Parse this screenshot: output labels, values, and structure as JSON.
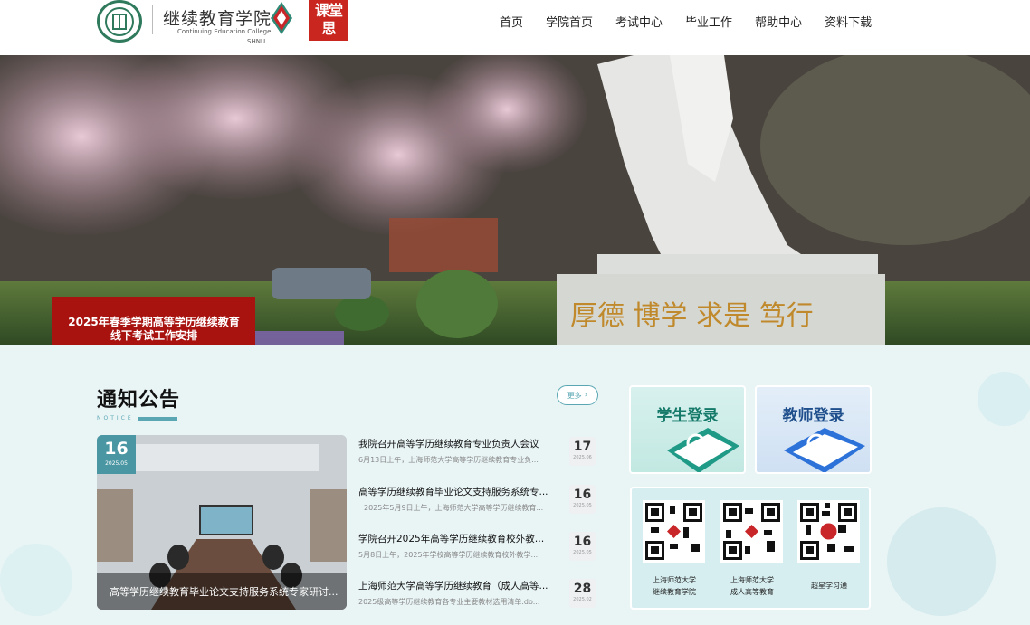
{
  "header": {
    "college_name": "继续教育学院",
    "college_en": "Continuing Education College",
    "college_abbr": "SHNU",
    "ketang_logo": "课堂思",
    "seal_text": "上海师范大学"
  },
  "nav": [
    "首页",
    "学院首页",
    "考试中心",
    "毕业工作",
    "帮助中心",
    "资料下载"
  ],
  "banner": {
    "caption": "2025年春季学期高等学历继续教育线下考试工作安排",
    "monument_text": "厚德 博学 求是 笃行"
  },
  "notices": {
    "title": "通知公告",
    "subtitle": "NOTICE",
    "more_label": "更多",
    "featured": {
      "day": "16",
      "year_month": "2025.05",
      "caption": "高等学历继续教育毕业论文支持服务系统专家研讨..."
    },
    "items": [
      {
        "title": "我院召开高等学历继续教育专业负责人会议",
        "summary": "6月13日上午，上海师范大学高等学历继续教育专业负...",
        "day": "17",
        "year_month": "2025.06"
      },
      {
        "title": "高等学历继续教育毕业论文支持服务系统专...",
        "summary": "2025年5月9日上午，上海师范大学高等学历继续教育...",
        "day": "16",
        "year_month": "2025.05"
      },
      {
        "title": "学院召开2025年高等学历继续教育校外教学...",
        "summary": "5月8日上午，2025年学校高等学历继续教育校外教学...",
        "day": "16",
        "year_month": "2025.05"
      },
      {
        "title": "上海师范大学高等学历继续教育（成人高等...",
        "summary": "2025级高等学历继续教育各专业主要教材选用清单.do...",
        "day": "28",
        "year_month": "2025.02"
      }
    ]
  },
  "login": {
    "student": "学生登录",
    "teacher": "教师登录"
  },
  "qr_codes": [
    {
      "line1": "上海师范大学",
      "line2": "继续教育学院"
    },
    {
      "line1": "上海师范大学",
      "line2": "成人高等教育"
    },
    {
      "line1": "超星学习通",
      "line2": ""
    }
  ],
  "colors": {
    "accent": "#5aa7b3",
    "banner_red": "#a8120f",
    "logo_green": "#2f7a5d",
    "ketang_red": "#c8261e"
  }
}
